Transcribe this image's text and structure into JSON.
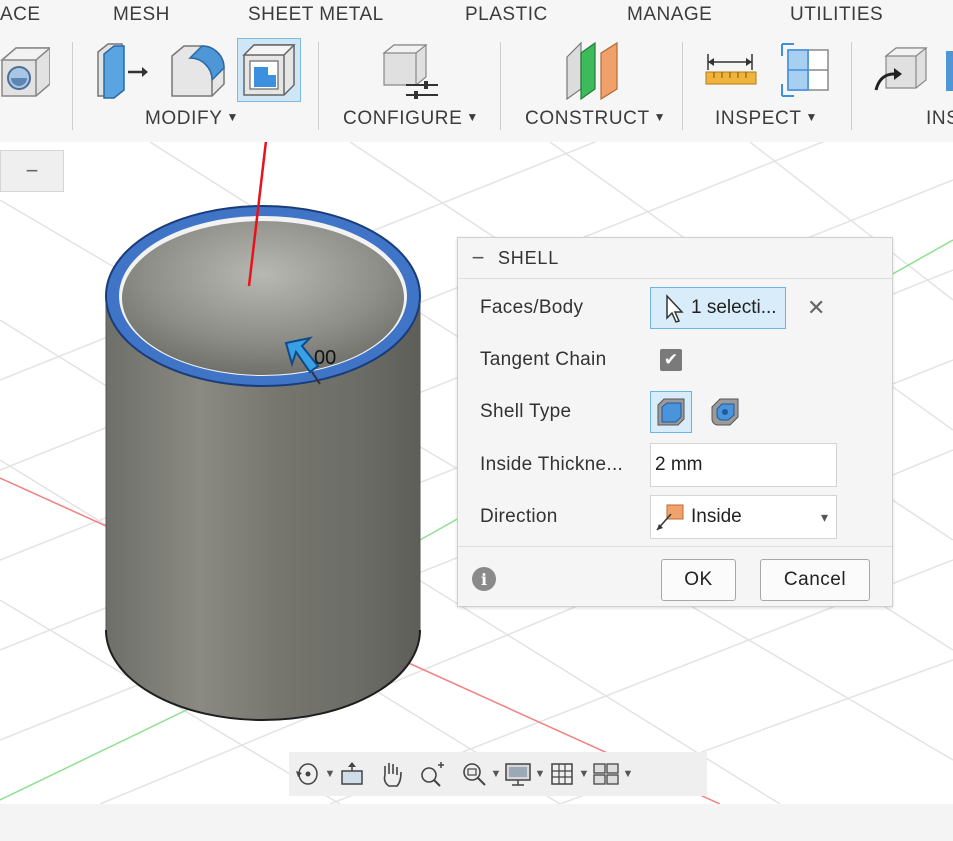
{
  "tabs": [
    "ACE",
    "MESH",
    "SHEET METAL",
    "PLASTIC",
    "MANAGE",
    "UTILITIES"
  ],
  "groups": {
    "modify": "MODIFY",
    "configure": "CONFIGURE",
    "construct": "CONSTRUCT",
    "inspect": "INSPECT",
    "insert": "INS"
  },
  "collapse_symbol": "−",
  "dialog": {
    "title": "SHELL",
    "minimize_symbol": "−",
    "faces_label": "Faces/Body",
    "faces_value": "1 selecti...",
    "clear_symbol": "✕",
    "tangent_label": "Tangent Chain",
    "tangent_checked": true,
    "check_symbol": "✔",
    "shell_type_label": "Shell Type",
    "thickness_label": "Inside Thickne...",
    "thickness_value": "2 mm",
    "direction_label": "Direction",
    "direction_value": "Inside",
    "dropdown_caret": "▾",
    "info_symbol": "i",
    "ok_label": "OK",
    "cancel_label": "Cancel"
  },
  "viewport": {
    "cursor_label": "00"
  },
  "navbar": {
    "icons": [
      "orbit-icon",
      "look-at-icon",
      "pan-icon",
      "zoom-icon",
      "fit-icon",
      "display-settings-icon",
      "grid-icon",
      "viewports-icon"
    ]
  },
  "colors": {
    "selection_blue": "#3f74c6",
    "cylinder_gray": "#7a7a74",
    "annotation_red": "#e8121a",
    "highlight_bg": "#d8ecf9",
    "highlight_border": "#6eb2e2"
  }
}
